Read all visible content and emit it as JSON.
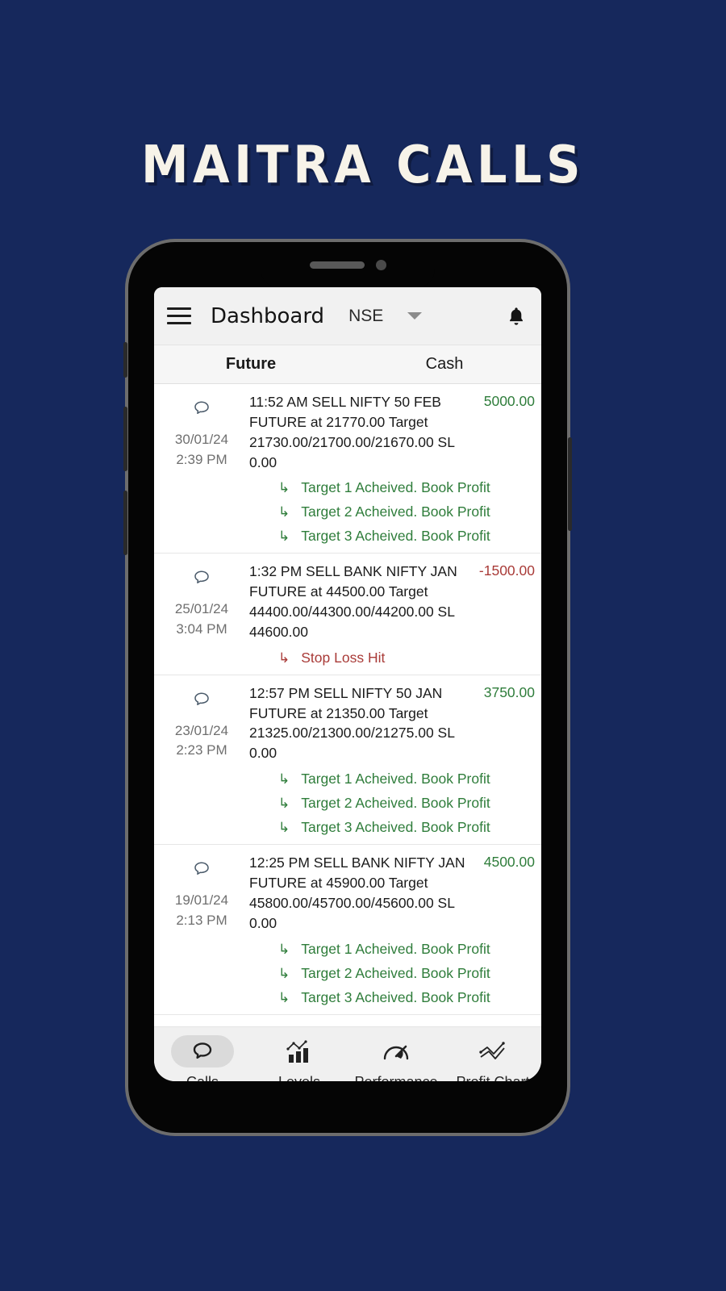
{
  "hero": {
    "title": "MAITRA CALLS",
    "background_color": "#16285c",
    "title_color": "#f7f3e9"
  },
  "appbar": {
    "menu_icon": "hamburger-menu-icon",
    "title": "Dashboard",
    "exchange": "NSE",
    "dropdown_icon": "chevron-down-icon",
    "notification_icon": "bell-icon"
  },
  "tabs": [
    {
      "label": "Future",
      "active": true
    },
    {
      "label": "Cash",
      "active": false
    }
  ],
  "calls": [
    {
      "date": "30/01/24",
      "time": "2:39 PM",
      "icon": "speech-bubble-icon",
      "text": "11:52 AM SELL NIFTY 50 FEB FUTURE at 21770.00 Target 21730.00/21700.00/21670.00 SL 0.00",
      "pnl": "5000.00",
      "pnl_type": "profit",
      "statuses": [
        {
          "text": "Target 1 Acheived. Book Profit",
          "type": "ok"
        },
        {
          "text": "Target 2 Acheived. Book Profit",
          "type": "ok"
        },
        {
          "text": "Target 3 Acheived. Book Profit",
          "type": "ok"
        }
      ]
    },
    {
      "date": "25/01/24",
      "time": "3:04 PM",
      "icon": "speech-bubble-icon",
      "text": "1:32 PM SELL BANK NIFTY JAN FUTURE at 44500.00 Target 44400.00/44300.00/44200.00 SL 44600.00",
      "pnl": "-1500.00",
      "pnl_type": "loss",
      "statuses": [
        {
          "text": "Stop Loss Hit",
          "type": "fail"
        }
      ]
    },
    {
      "date": "23/01/24",
      "time": "2:23 PM",
      "icon": "speech-bubble-icon",
      "text": "12:57 PM SELL NIFTY 50 JAN FUTURE at 21350.00 Target 21325.00/21300.00/21275.00 SL 0.00",
      "pnl": "3750.00",
      "pnl_type": "profit",
      "statuses": [
        {
          "text": "Target 1 Acheived. Book Profit",
          "type": "ok"
        },
        {
          "text": "Target 2 Acheived. Book Profit",
          "type": "ok"
        },
        {
          "text": "Target 3 Acheived. Book Profit",
          "type": "ok"
        }
      ]
    },
    {
      "date": "19/01/24",
      "time": "2:13 PM",
      "icon": "speech-bubble-icon",
      "text": "12:25 PM SELL BANK NIFTY JAN FUTURE at 45900.00 Target 45800.00/45700.00/45600.00 SL 0.00",
      "pnl": "4500.00",
      "pnl_type": "profit",
      "statuses": [
        {
          "text": "Target 1 Acheived. Book Profit",
          "type": "ok"
        },
        {
          "text": "Target 2 Acheived. Book Profit",
          "type": "ok"
        },
        {
          "text": "Target 3 Acheived. Book Profit",
          "type": "ok"
        }
      ]
    }
  ],
  "bottom_nav": [
    {
      "label": "Calls",
      "icon": "speech-bubble-icon",
      "active": true
    },
    {
      "label": "Levels",
      "icon": "bar-chart-icon",
      "active": false
    },
    {
      "label": "Performance",
      "icon": "speedometer-icon",
      "active": false
    },
    {
      "label": "Profit Chart",
      "icon": "line-chart-icon",
      "active": false
    }
  ],
  "system_nav": [
    {
      "name": "recents-button",
      "icon": "recents-icon"
    },
    {
      "name": "home-button",
      "icon": "home-square-icon"
    },
    {
      "name": "back-button",
      "icon": "back-triangle-icon"
    }
  ],
  "colors": {
    "background": "#16285c",
    "profit": "#2f7d3b",
    "loss": "#a93b38",
    "appbar": "#f1f1f1"
  }
}
